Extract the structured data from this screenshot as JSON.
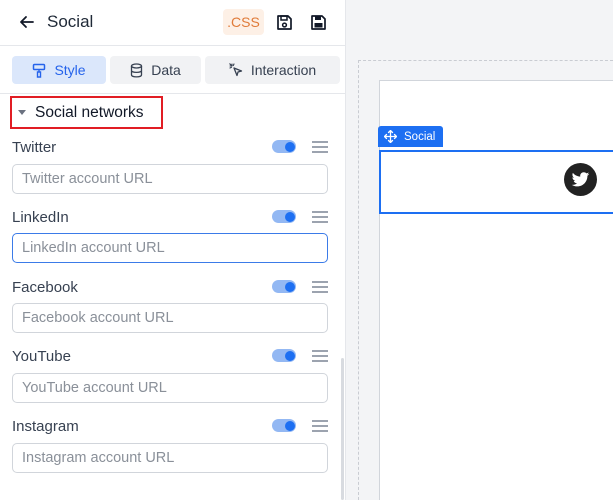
{
  "header": {
    "title": "Social",
    "css_label": ".CSS"
  },
  "tabs": [
    {
      "label": "Style",
      "icon": "paint-roller-icon",
      "active": true
    },
    {
      "label": "Data",
      "icon": "database-icon",
      "active": false
    },
    {
      "label": "Interaction",
      "icon": "pointer-click-icon",
      "active": false
    }
  ],
  "section": {
    "title": "Social networks",
    "expanded": true
  },
  "networks": [
    {
      "label": "Twitter",
      "placeholder": "Twitter account URL",
      "value": "",
      "enabled": true
    },
    {
      "label": "LinkedIn",
      "placeholder": "LinkedIn account URL",
      "value": "",
      "enabled": true
    },
    {
      "label": "Facebook",
      "placeholder": "Facebook account URL",
      "value": "",
      "enabled": true
    },
    {
      "label": "YouTube",
      "placeholder": "YouTube account URL",
      "value": "",
      "enabled": true
    },
    {
      "label": "Instagram",
      "placeholder": "Instagram account URL",
      "value": "",
      "enabled": true
    }
  ],
  "canvas": {
    "widget_label": "Social",
    "icons": [
      "twitter-icon"
    ]
  },
  "colors": {
    "accent": "#1d6ff2",
    "css_badge_text": "#e07b39",
    "highlight_border": "#e11d24"
  }
}
